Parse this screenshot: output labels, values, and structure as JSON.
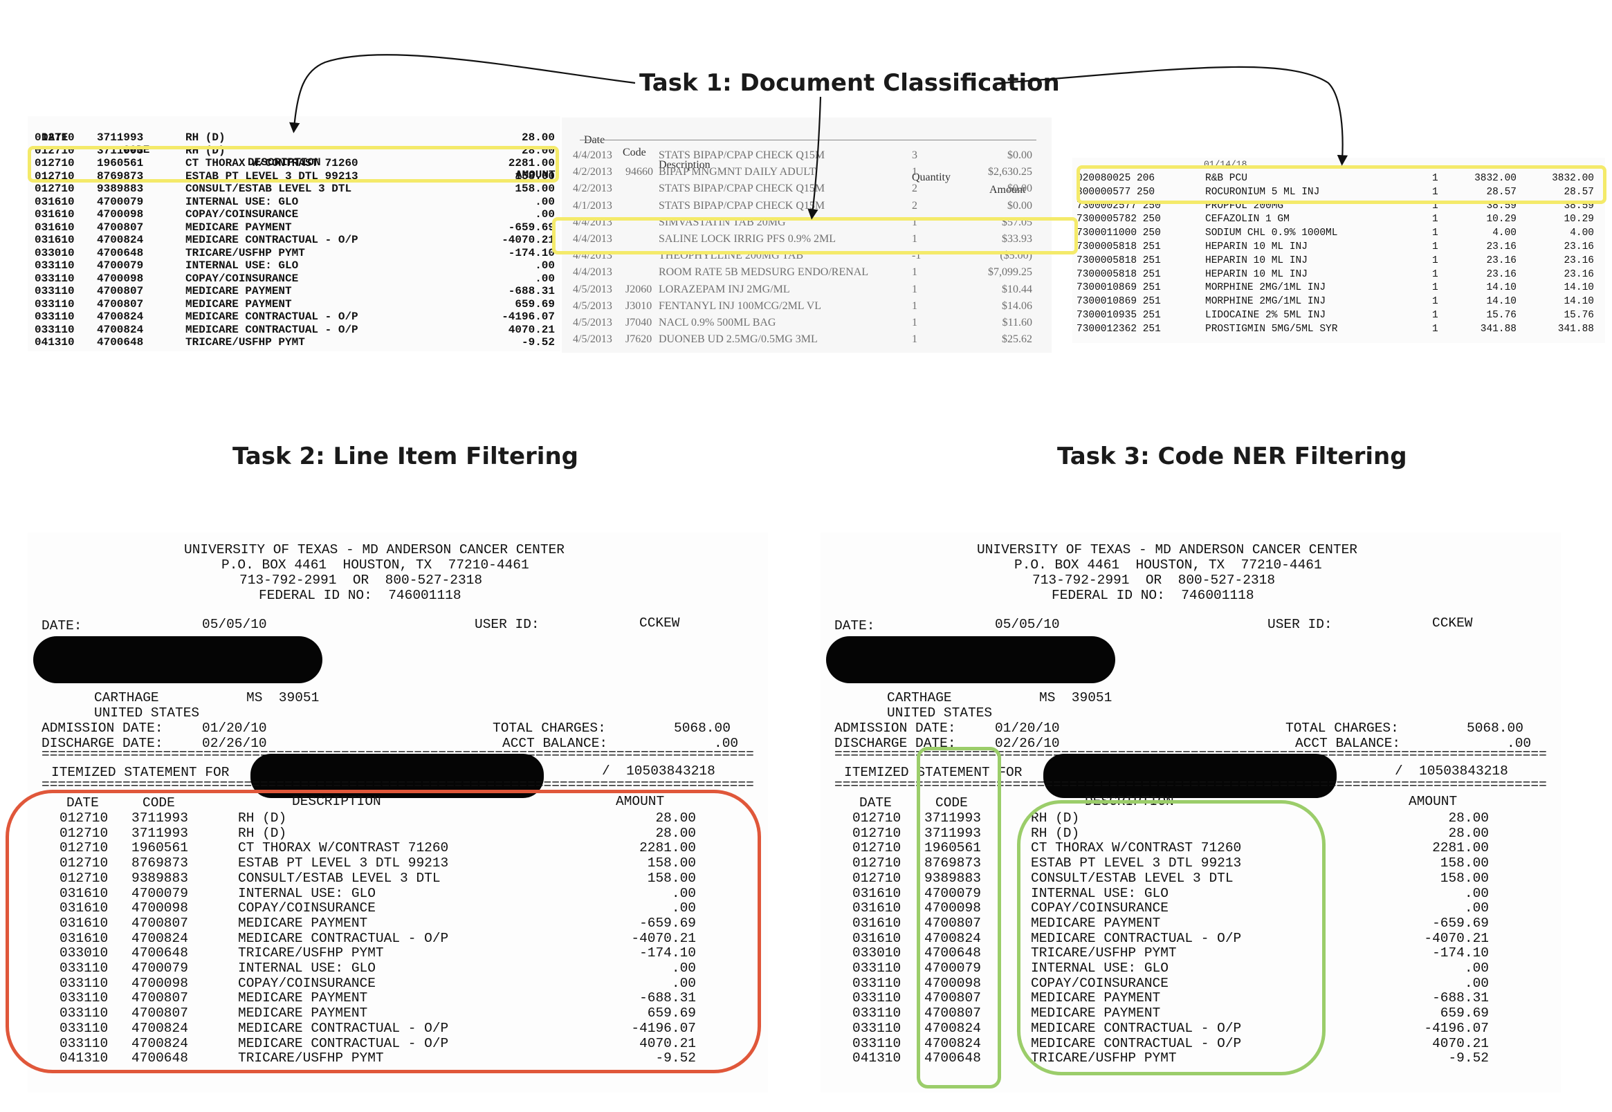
{
  "titles": {
    "task1": "Task 1: Document Classification",
    "task2": "Task 2: Line Item Filtering",
    "task3": "Task 3: Code NER Filtering"
  },
  "colors": {
    "highlight": "#f4ea6a",
    "line_item_box": "#e0573a",
    "code_box": "#9bcd6a",
    "redaction": "#050505"
  },
  "doc1": {
    "headers": {
      "date": "DATE",
      "code": "CODE",
      "description": "DESCRIPTION",
      "amount": "AMOUNT"
    },
    "rows": [
      {
        "date": "012710",
        "code": "3711993",
        "desc": "RH (D)",
        "amount": "28.00"
      },
      {
        "date": "012710",
        "code": "3711993",
        "desc": "RH (D)",
        "amount": "28.00"
      },
      {
        "date": "012710",
        "code": "1960561",
        "desc": "CT THORAX W/CONTRAST 71260",
        "amount": "2281.00"
      },
      {
        "date": "012710",
        "code": "8769873",
        "desc": "ESTAB PT LEVEL 3 DTL 99213",
        "amount": "158.00"
      },
      {
        "date": "012710",
        "code": "9389883",
        "desc": "CONSULT/ESTAB LEVEL 3 DTL",
        "amount": "158.00"
      },
      {
        "date": "031610",
        "code": "4700079",
        "desc": "INTERNAL USE: GLO",
        "amount": ".00"
      },
      {
        "date": "031610",
        "code": "4700098",
        "desc": "COPAY/COINSURANCE",
        "amount": ".00"
      },
      {
        "date": "031610",
        "code": "4700807",
        "desc": "MEDICARE PAYMENT",
        "amount": "-659.69"
      },
      {
        "date": "031610",
        "code": "4700824",
        "desc": "MEDICARE CONTRACTUAL - O/P",
        "amount": "-4070.21"
      },
      {
        "date": "033010",
        "code": "4700648",
        "desc": "TRICARE/USFHP PYMT",
        "amount": "-174.10"
      },
      {
        "date": "033110",
        "code": "4700079",
        "desc": "INTERNAL USE: GLO",
        "amount": ".00"
      },
      {
        "date": "033110",
        "code": "4700098",
        "desc": "COPAY/COINSURANCE",
        "amount": ".00"
      },
      {
        "date": "033110",
        "code": "4700807",
        "desc": "MEDICARE PAYMENT",
        "amount": "-688.31"
      },
      {
        "date": "033110",
        "code": "4700807",
        "desc": "MEDICARE PAYMENT",
        "amount": "659.69"
      },
      {
        "date": "033110",
        "code": "4700824",
        "desc": "MEDICARE CONTRACTUAL - O/P",
        "amount": "-4196.07"
      },
      {
        "date": "033110",
        "code": "4700824",
        "desc": "MEDICARE CONTRACTUAL - O/P",
        "amount": "4070.21"
      },
      {
        "date": "041310",
        "code": "4700648",
        "desc": "TRICARE/USFHP PYMT",
        "amount": "-9.52"
      }
    ]
  },
  "doc2": {
    "headers": {
      "date": "Date",
      "code": "Code",
      "description": "Description",
      "quantity": "Quantity",
      "amount": "Amount"
    },
    "rows": [
      {
        "date": "4/4/2013",
        "code": "",
        "desc": "STATS BIPAP/CPAP CHECK Q15M",
        "qty": "3",
        "amount": "$0.00"
      },
      {
        "date": "4/2/2013",
        "code": "94660",
        "desc": "BIPAP MNGMNT DAILY ADULT",
        "qty": "1",
        "amount": "$2,630.25"
      },
      {
        "date": "4/2/2013",
        "code": "",
        "desc": "STATS BIPAP/CPAP CHECK Q15M",
        "qty": "2",
        "amount": "$0.00"
      },
      {
        "date": "4/1/2013",
        "code": "",
        "desc": "STATS BIPAP/CPAP CHECK Q15M",
        "qty": "2",
        "amount": "$0.00"
      },
      {
        "date": "4/4/2013",
        "code": "",
        "desc": "SIMVASTATIN TAB 20MG",
        "qty": "1",
        "amount": "$57.05"
      },
      {
        "date": "4/4/2013",
        "code": "",
        "desc": "SALINE LOCK IRRIG PFS 0.9% 2ML",
        "qty": "1",
        "amount": "$33.93"
      },
      {
        "date": "4/4/2013",
        "code": "",
        "desc": "THEOPHYLLINE 200MG TAB",
        "qty": "-1",
        "amount": "($5.00)"
      },
      {
        "date": "4/4/2013",
        "code": "",
        "desc": "ROOM RATE 5B MEDSURG ENDO/RENAL",
        "qty": "1",
        "amount": "$7,099.25"
      },
      {
        "date": "4/5/2013",
        "code": "J2060",
        "desc": "LORAZEPAM INJ 2MG/ML",
        "qty": "1",
        "amount": "$10.44"
      },
      {
        "date": "4/5/2013",
        "code": "J3010",
        "desc": "FENTANYL INJ 100MCG/2ML VL",
        "qty": "1",
        "amount": "$14.06"
      },
      {
        "date": "4/5/2013",
        "code": "J7040",
        "desc": "NACL 0.9% 500ML BAG",
        "qty": "1",
        "amount": "$11.60"
      },
      {
        "date": "4/5/2013",
        "code": "J7620",
        "desc": "DUONEB UD 2.5MG/0.5MG 3ML",
        "qty": "1",
        "amount": "$25.62"
      }
    ]
  },
  "doc3": {
    "date_fragment": "01/14/18",
    "rows": [
      {
        "id": "020080025 206",
        "desc": "R&B PCU",
        "qty": "1",
        "price": "3832.00",
        "total": "3832.00"
      },
      {
        "id": "300000577 250",
        "desc": "ROCURONIUM 5 ML INJ",
        "qty": "1",
        "price": "28.57",
        "total": "28.57"
      },
      {
        "id": "7300002577 250",
        "desc": "PROPFOL 200MG",
        "qty": "1",
        "price": "38.59",
        "total": "38.59"
      },
      {
        "id": "7300005782 250",
        "desc": "CEFAZOLIN 1 GM",
        "qty": "1",
        "price": "10.29",
        "total": "10.29"
      },
      {
        "id": "7300011000 250",
        "desc": "SODIUM CHL 0.9% 1000ML",
        "qty": "1",
        "price": "4.00",
        "total": "4.00"
      },
      {
        "id": "7300005818 251",
        "desc": "HEPARIN 10 ML INJ",
        "qty": "1",
        "price": "23.16",
        "total": "23.16"
      },
      {
        "id": "7300005818 251",
        "desc": "HEPARIN 10 ML INJ",
        "qty": "1",
        "price": "23.16",
        "total": "23.16"
      },
      {
        "id": "7300005818 251",
        "desc": "HEPARIN 10 ML INJ",
        "qty": "1",
        "price": "23.16",
        "total": "23.16"
      },
      {
        "id": "7300010869 251",
        "desc": "MORPHINE 2MG/1ML INJ",
        "qty": "1",
        "price": "14.10",
        "total": "14.10"
      },
      {
        "id": "7300010869 251",
        "desc": "MORPHINE 2MG/1ML INJ",
        "qty": "1",
        "price": "14.10",
        "total": "14.10"
      },
      {
        "id": "7300010935 251",
        "desc": "LIDOCAINE 2% 5ML INJ",
        "qty": "1",
        "price": "15.76",
        "total": "15.76"
      },
      {
        "id": "7300012362 251",
        "desc": "PROSTIGMIN 5MG/5ML SYR",
        "qty": "1",
        "price": "341.88",
        "total": "341.88"
      }
    ]
  },
  "statement": {
    "hospital": "UNIVERSITY OF TEXAS - MD ANDERSON CANCER CENTER",
    "address": "P.O. BOX 4461  HOUSTON, TX  77210-4461",
    "phones": "713-792-2991  OR  800-527-2318",
    "federal_id": "FEDERAL ID NO:  746001118",
    "date_label": "DATE:",
    "date_value": "05/05/10",
    "user_label": "USER ID:",
    "user_value": "CCKEW",
    "city": "CARTHAGE",
    "state": "MS  39051",
    "country": "UNITED STATES",
    "admission_label": "ADMISSION DATE:",
    "admission_value": "01/20/10",
    "discharge_label": "DISCHARGE DATE:",
    "discharge_value": "02/26/10",
    "total_label": "TOTAL CHARGES:",
    "total_value": "5068.00",
    "balance_label": "ACCT BALANCE:",
    "balance_value": ".00",
    "itemized_label": "ITEMIZED STATEMENT FOR",
    "account": "/  10503843218",
    "divider": "================================================================================================================================"
  }
}
